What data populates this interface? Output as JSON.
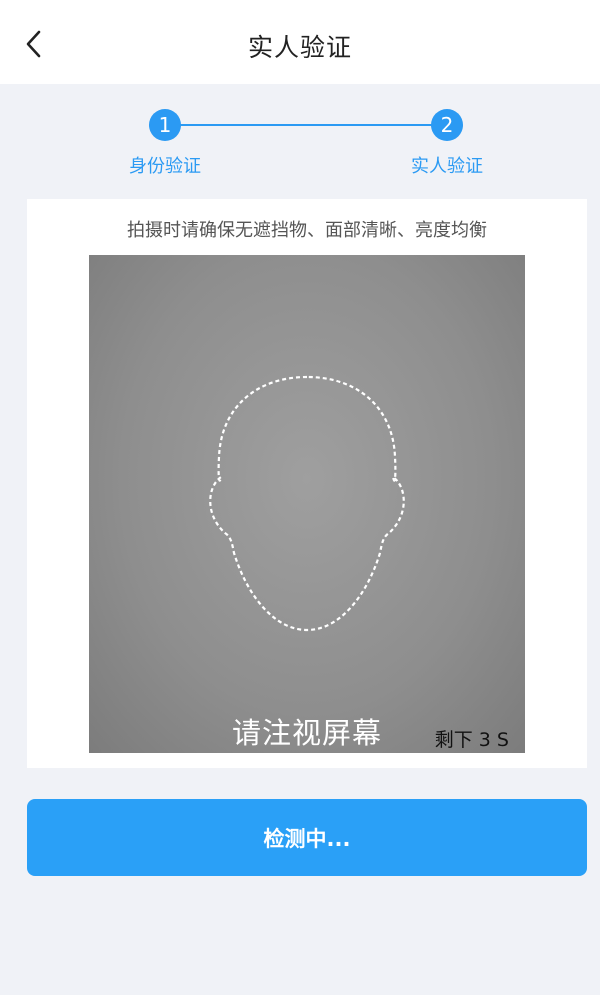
{
  "header": {
    "title": "实人验证",
    "back_icon": "chevron-left-icon"
  },
  "stepper": {
    "steps": [
      {
        "number": "1",
        "label": "身份验证"
      },
      {
        "number": "2",
        "label": "实人验证"
      }
    ],
    "accent_color": "#2b9af3"
  },
  "camera": {
    "hint": "拍摄时请确保无遮挡物、面部清晰、亮度均衡",
    "prompt": "请注视屏幕",
    "countdown": "剩下 3 S"
  },
  "action": {
    "label": "检测中...",
    "color": "#2aa0f7"
  }
}
